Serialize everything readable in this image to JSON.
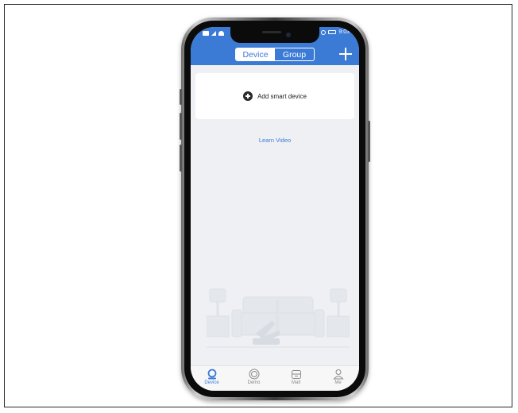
{
  "status_bar": {
    "time": "9:03"
  },
  "header": {
    "tabs": [
      {
        "label": "Device",
        "active": true
      },
      {
        "label": "Group",
        "active": false
      }
    ],
    "add_icon": "plus-icon"
  },
  "main": {
    "add_device_label": "Add smart device",
    "learn_video_label": "Learn Video"
  },
  "bottom_nav": {
    "items": [
      {
        "label": "Device",
        "icon": "device-icon",
        "active": true
      },
      {
        "label": "Demo",
        "icon": "demo-icon",
        "active": false
      },
      {
        "label": "Mall",
        "icon": "mall-icon",
        "active": false
      },
      {
        "label": "Me",
        "icon": "user-icon",
        "active": false
      }
    ]
  },
  "colors": {
    "accent": "#3b7bd6",
    "background": "#eef0f4",
    "card": "#ffffff"
  }
}
